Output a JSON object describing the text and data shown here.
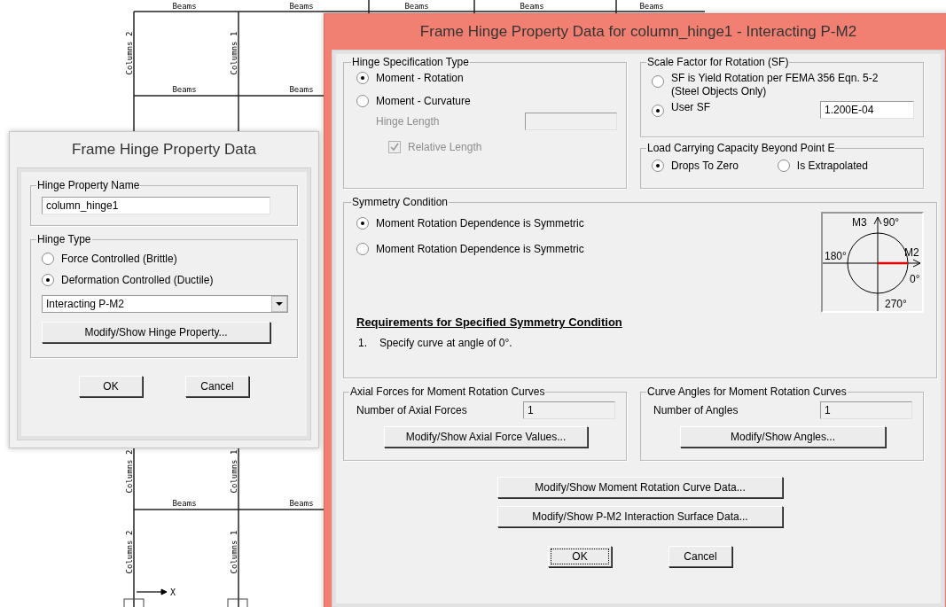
{
  "drawing": {
    "top_beams": [
      "Beams",
      "Beams",
      "Beams",
      "Beams",
      "Beams"
    ],
    "middle_beams": [
      "Beams",
      "Beams"
    ],
    "bottom_beams": [
      "Beams",
      "Beams"
    ],
    "upper_columns": [
      "Columns 2",
      "Columns 1"
    ],
    "lower_columns": [
      "Columns 2",
      "Columns 1"
    ],
    "bottom_columns": [
      "Columns 2",
      "Columns 1"
    ],
    "axis_label": "X"
  },
  "left_dialog": {
    "title": "Frame Hinge Property Data",
    "name_group": {
      "legend": "Hinge Property Name",
      "value": "column_hinge1"
    },
    "type_group": {
      "legend": "Hinge Type",
      "options": [
        {
          "label": "Force Controlled  (Brittle)",
          "selected": false
        },
        {
          "label": "Deformation Controlled  (Ductile)",
          "selected": true
        }
      ],
      "dropdown": "Interacting P-M2",
      "button": "Modify/Show Hinge Property..."
    },
    "buttons": [
      {
        "label": "OK",
        "focused": false
      },
      {
        "label": "Cancel",
        "focused": false
      }
    ]
  },
  "right_dialog": {
    "title": "Frame Hinge Property Data for column_hinge1 - Interacting P-M2",
    "hinge_spec": {
      "legend": "Hinge Specification Type",
      "options": [
        {
          "label": "Moment - Rotation",
          "selected": true
        },
        {
          "label": "Moment - Curvature",
          "selected": false
        }
      ],
      "hinge_length_label": "Hinge Length",
      "relative_length": {
        "label": "Relative Length",
        "checked": true
      },
      "disabled": true
    },
    "scale_factor": {
      "legend": "Scale Factor for Rotation (SF)",
      "options": [
        {
          "label": "SF is Yield Rotation per FEMA 356 Eqn. 5-2",
          "note": "(Steel Objects Only)",
          "selected": false
        },
        {
          "label": "User SF",
          "selected": true
        }
      ],
      "value": "1.200E-04"
    },
    "load_capacity": {
      "legend": "Load Carrying Capacity Beyond Point E",
      "options": [
        {
          "label": "Drops To Zero",
          "selected": true
        },
        {
          "label": "Is Extrapolated",
          "selected": false
        }
      ]
    },
    "symmetry": {
      "legend": "Symmetry Condition",
      "options": [
        {
          "label": "Moment Rotation Dependence is Symmetric",
          "selected": true
        },
        {
          "label": "Moment Rotation Dependence is Symmetric",
          "selected": false
        }
      ],
      "requirements_title": "Requirements for Specified Symmetry Condition",
      "requirements": [
        {
          "number": "1.",
          "text": "Specify curve at angle of 0°."
        }
      ],
      "diagram_labels": [
        "M3",
        "90°",
        "180°",
        "M2",
        "0°",
        "270°"
      ]
    },
    "axial": {
      "legend": "Axial Forces for Moment Rotation Curves",
      "label": "Number of Axial Forces",
      "value": "1",
      "button": "Modify/Show Axial Force Values..."
    },
    "angles": {
      "legend": "Curve Angles for Moment Rotation Curves",
      "label": "Number of Angles",
      "value": "1",
      "button": "Modify/Show Angles..."
    },
    "buttons": [
      "Modify/Show Moment Rotation Curve Data...",
      "Modify/Show P-M2 Interaction Surface Data..."
    ],
    "footer": [
      {
        "label": "OK",
        "focused": true
      },
      {
        "label": "Cancel",
        "focused": false
      }
    ]
  }
}
